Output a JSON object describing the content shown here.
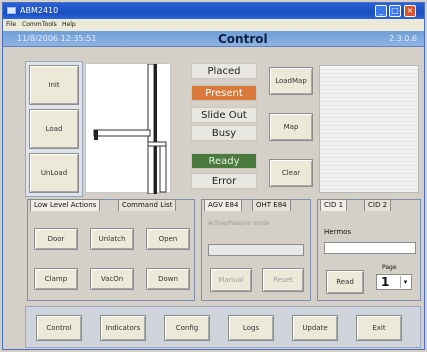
{
  "window": {
    "title": "ABM2410",
    "menu": [
      "File",
      "Comm",
      "Tools",
      "Help"
    ]
  },
  "header": {
    "datetime": "11/8/2006 12:35:51",
    "title": "Control",
    "version": "2.3.0.6"
  },
  "left_buttons": [
    "Init",
    "Load",
    "UnLoad"
  ],
  "status_labels": [
    {
      "label": "Placed",
      "bg": "#e7e6e0",
      "fg": "#222"
    },
    {
      "label": "Present",
      "bg": "#d97a3a",
      "fg": "#ffffff"
    },
    {
      "label": "Slide Out",
      "bg": "#e7e6e0",
      "fg": "#222"
    },
    {
      "label": "Busy",
      "bg": "#e7e6e0",
      "fg": "#222"
    },
    {
      "label": "Ready",
      "bg": "#4a7a3e",
      "fg": "#e8f0e0"
    },
    {
      "label": "Error",
      "bg": "#e7e6e0",
      "fg": "#222"
    }
  ],
  "mid_buttons": [
    "LoadMap",
    "Map",
    "Clear"
  ],
  "low_level": {
    "tabs": [
      "Low Level Actions",
      "Command List"
    ],
    "buttons": [
      "Door",
      "Unlatch",
      "Open",
      "Clamp",
      "VacOn",
      "Down"
    ]
  },
  "agv": {
    "tabs": [
      "AGV E84",
      "OHT E84"
    ],
    "field_label": "Active/Passive mode",
    "buttons": [
      "Manual",
      "Reset"
    ]
  },
  "cid": {
    "tabs": [
      "CID 1",
      "CID 2"
    ],
    "field_label": "Hermos",
    "read_button": "Read",
    "page_label": "Page",
    "page_value": "1"
  },
  "bottom_buttons": [
    "Control",
    "Indicators",
    "Config",
    "Logs",
    "Update",
    "Exit"
  ]
}
